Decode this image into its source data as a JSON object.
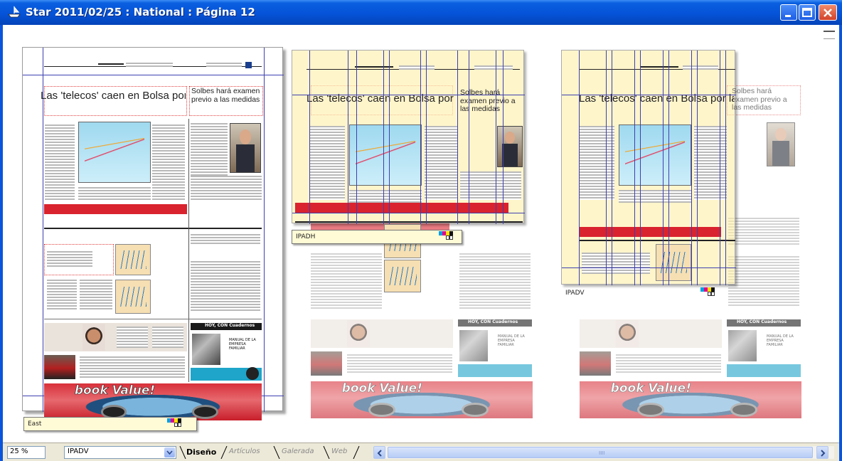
{
  "window": {
    "title": "Star 2011/02/25 : National : Página 12",
    "icon": "ship-icon",
    "controls": [
      "minimize-icon",
      "maximize-icon",
      "close-icon"
    ]
  },
  "pages": {
    "main": {
      "headline": "Las 'telecos' caen en Bolsa por la rebaja en la valoración de",
      "side_headline": "Solbes hará examen previo a las medidas",
      "ad_text": "book Value!",
      "promo_title": "HOY, CON Cuadernos",
      "promo_body": "MANUAL DE LA EMPRESA FAMILIAR",
      "layout_tag": "East"
    },
    "middle": {
      "headline": "Las 'telecos' caen en Bolsa por la rebaja en la valoración de",
      "side_headline": "Solbes hará examen previo a las medidas",
      "ad_text": "book Value!",
      "promo_title": "HOY, CON Cuadernos",
      "promo_body": "MANUAL DE LA EMPRESA FAMILIAR",
      "layout_tag": "IPADH"
    },
    "right": {
      "headline": "Las 'telecos' caen en Bolsa por la rebaja en la valoración de",
      "side_headline": "Solbes hará examen previo a las medidas",
      "ad_text": "book Value!",
      "promo_title": "HOY, CON Cuadernos",
      "promo_body": "MANUAL DE LA EMPRESA FAMILIAR",
      "layout_tag": "IPADV"
    }
  },
  "statusbar": {
    "zoom": "25 %",
    "layout_select": "IPADV",
    "tabs": [
      {
        "label": "Diseño",
        "active": true
      },
      {
        "label": "Artículos",
        "active": false
      },
      {
        "label": "Galerada",
        "active": false
      },
      {
        "label": "Web",
        "active": false
      }
    ],
    "scroll_grip": "IIII"
  },
  "colors": {
    "titlebar": "#0553d8",
    "guide": "#3d3fb0",
    "frame_dots": "#e04040",
    "mask": "#ffeca0",
    "ad_red": "#d9232e"
  }
}
